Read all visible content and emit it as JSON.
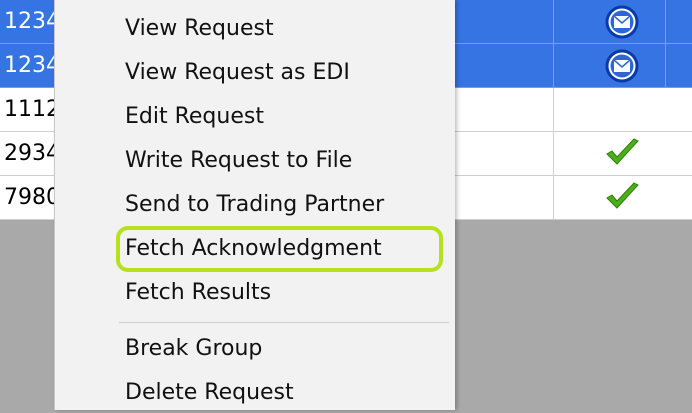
{
  "grid": {
    "rows": [
      {
        "id": "1234",
        "selected": true,
        "status_icon": "envelope-icon"
      },
      {
        "id": "1234",
        "selected": true,
        "status_icon": "envelope-icon"
      },
      {
        "id": "1112",
        "selected": false,
        "status_icon": ""
      },
      {
        "id": "2934",
        "selected": false,
        "status_icon": "checkmark-icon"
      },
      {
        "id": "7980",
        "selected": false,
        "status_icon": "checkmark-icon"
      }
    ]
  },
  "context_menu": {
    "items": [
      {
        "label": "View Request"
      },
      {
        "label": "View Request as EDI"
      },
      {
        "label": "Edit Request"
      },
      {
        "label": "Write Request to File"
      },
      {
        "label": "Send to Trading Partner"
      },
      {
        "label": "Fetch Acknowledgment",
        "highlighted": true
      },
      {
        "label": "Fetch Results"
      },
      {
        "label": "Break Group"
      },
      {
        "label": "Delete Request"
      }
    ]
  },
  "colors": {
    "selection": "#3574e2",
    "highlight": "#b6e11c",
    "check": "#4caf1a",
    "backdrop": "#a9a9a9"
  }
}
